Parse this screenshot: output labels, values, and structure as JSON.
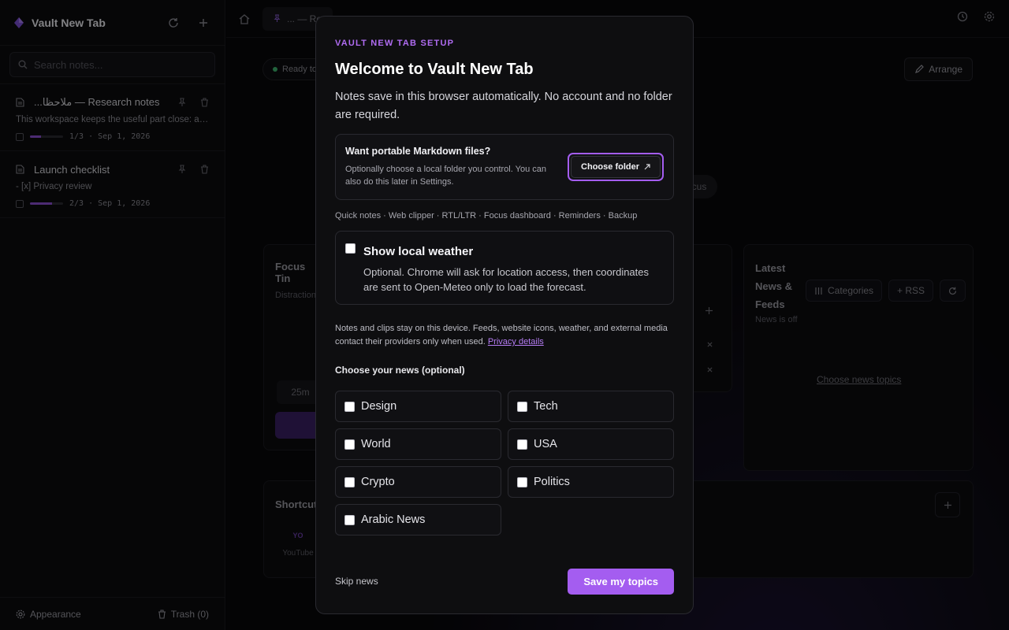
{
  "sidebar": {
    "app_title": "Vault New Tab",
    "search_placeholder": "Search notes...",
    "notes": [
      {
        "title": "...ملاحظا — Research notes",
        "preview": "This workspace keeps the useful part close: a c...",
        "progress_text": "1/3 · Sep 1, 2026",
        "progress": 0.33
      },
      {
        "title": "Launch checklist",
        "preview": "- [x] Privacy review",
        "progress_text": "2/3 · Sep 1, 2026",
        "progress": 0.67
      }
    ],
    "footer": {
      "appearance": "Appearance",
      "trash": "Trash (0)"
    }
  },
  "background": {
    "tab_label": "... — Re",
    "status": "Ready to",
    "arrange": "Arrange",
    "focus_chip": "ocus",
    "focus_card_title": "Focus Tin",
    "focus_card_sub": "Distraction",
    "timer_chip": "25m",
    "news_card_title_1": "Latest",
    "news_card_title_2": "News &",
    "news_card_title_3": "Feeds",
    "news_off": "News is off",
    "categories": "Categories",
    "rss": "+ RSS",
    "choose_news_topics": "Choose news topics",
    "shortcuts": "Shortcuts",
    "yt_abbr": "YO",
    "youtube": "YouTube"
  },
  "modal": {
    "eyebrow": "VAULT NEW TAB SETUP",
    "title": "Welcome to Vault New Tab",
    "description": "Notes save in this browser automatically. No account and no folder are required.",
    "folder": {
      "title": "Want portable Markdown files?",
      "description": "Optionally choose a local folder you control. You can also do this later in Settings.",
      "button": "Choose folder"
    },
    "features": "Quick notes · Web clipper · RTL/LTR · Focus dashboard · Reminders · Backup",
    "weather": {
      "title": "Show local weather",
      "description": "Optional. Chrome will ask for location access, then coordinates are sent to Open-Meteo only to load the forecast."
    },
    "privacy_text": "Notes and clips stay on this device. Feeds, website icons, weather, and external media contact their providers only when used.",
    "privacy_link": "Privacy details",
    "news_heading": "Choose your news (optional)",
    "topics": [
      "Design",
      "Tech",
      "World",
      "USA",
      "Crypto",
      "Politics",
      "Arabic News"
    ],
    "skip": "Skip news",
    "save": "Save my topics"
  },
  "colors": {
    "accent": "#a45df0",
    "background": "#050506",
    "surface": "#0e0e10"
  }
}
